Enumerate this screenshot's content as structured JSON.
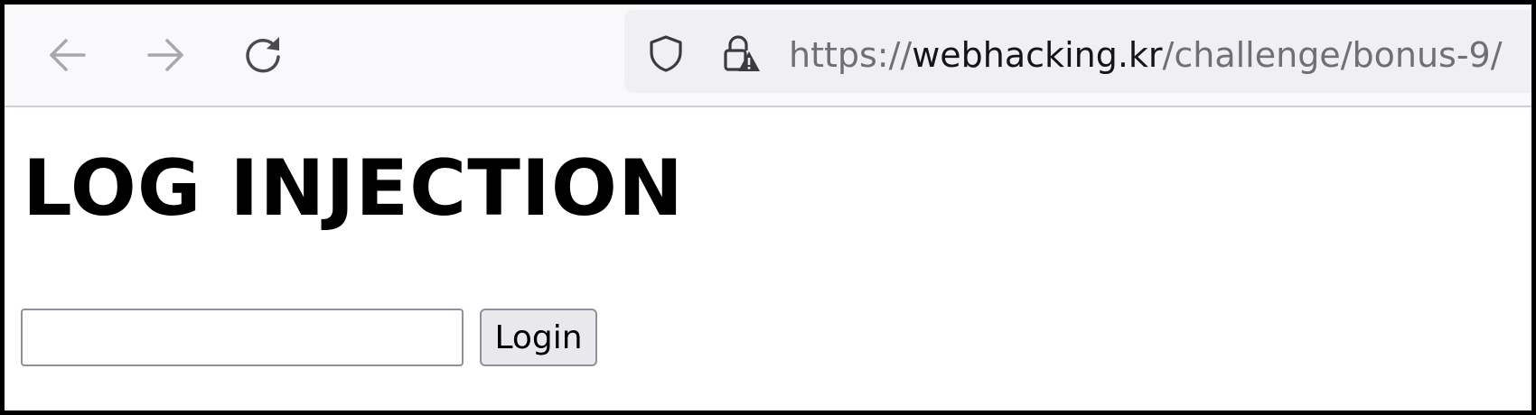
{
  "browser": {
    "url": {
      "scheme": "https://",
      "domain": "webhacking.kr",
      "path": "/challenge/bonus-9/"
    },
    "icons": {
      "back": "arrow-left-icon",
      "forward": "arrow-right-icon",
      "reload": "reload-icon",
      "tracking_protection": "shield-icon",
      "security": "lock-warning-icon"
    },
    "colors": {
      "toolbar_bg": "#f9f9fb",
      "urlbar_bg": "#f0f0f4",
      "url_dim_text": "#6f6f76",
      "url_domain_text": "#15141a"
    }
  },
  "page": {
    "title": "LOG INJECTION",
    "form": {
      "input_value": "",
      "submit_label": "Login"
    },
    "colors": {
      "button_bg": "#e9e9ed",
      "border": "#8f8f9d"
    }
  }
}
